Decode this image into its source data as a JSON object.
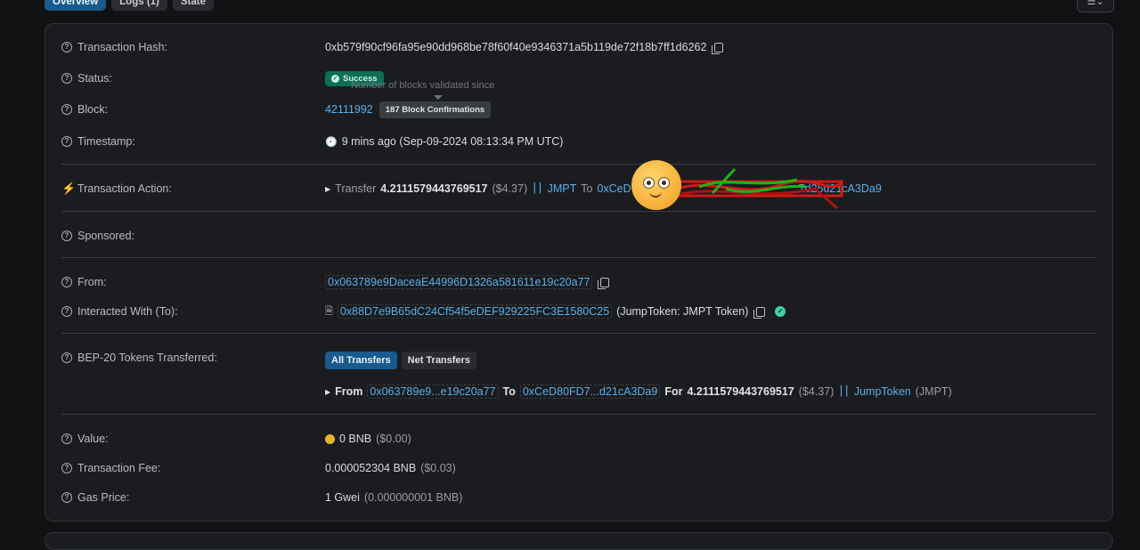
{
  "tabs": [
    {
      "label": "Overview",
      "active": true
    },
    {
      "label": "Logs (1)",
      "active": false
    },
    {
      "label": "State",
      "active": false
    }
  ],
  "view_toggle_icon": "list-view-icon",
  "rows": {
    "tx_hash": {
      "label": "Transaction Hash:",
      "value": "0xb579f90cf96fa95e90dd968be78f60f40e9346371a5b119de72f18b7ff1d6262"
    },
    "status": {
      "label": "Status:",
      "value": "Success",
      "tooltip": "Number of blocks validated since"
    },
    "block": {
      "label": "Block:",
      "value": "42111992",
      "confirmations": "187 Block Confirmations"
    },
    "timestamp": {
      "label": "Timestamp:",
      "value": "9 mins ago (Sep-09-2024 08:13:34 PM UTC)"
    },
    "action": {
      "label": "Transaction Action:",
      "prefix": "Transfer",
      "amount": "4.2111579443769517",
      "usd": "($4.37)",
      "token": "JMPT",
      "to_word": "To",
      "to_start": "0xCeD",
      "to_end": "7d25d21cA3Da9"
    },
    "sponsored": {
      "label": "Sponsored:"
    },
    "from": {
      "label": "From:",
      "value": "0x063789e9DaceaE44996D1326a581611e19c20a77"
    },
    "interacted": {
      "label": "Interacted With (To):",
      "value": "0x88D7e9B65dC24Cf54f5eDEF929225FC3E1580C25",
      "name": "(JumpToken: JMPT Token)"
    },
    "bep20": {
      "label": "BEP-20 Tokens Transferred:",
      "tab_all": "All Transfers",
      "tab_net": "Net Transfers",
      "from_word": "From",
      "from_addr": "0x063789e9...e19c20a77",
      "to_word": "To",
      "to_addr": "0xCeD80FD7...d21cA3Da9",
      "for_word": "For",
      "amount": "4.2111579443769517",
      "usd": "($4.37)",
      "token_name": "JumpToken",
      "token_symbol": "(JMPT)"
    },
    "value": {
      "label": "Value:",
      "amount": "0 BNB",
      "usd": "($0.00)"
    },
    "fee": {
      "label": "Transaction Fee:",
      "amount": "0.000052304 BNB",
      "usd": "($0.03)"
    },
    "gas": {
      "label": "Gas Price:",
      "amount": "1 Gwei",
      "detail": "(0.000000001 BNB)"
    }
  },
  "colors": {
    "accent": "#5aaee8",
    "success": "#0e6e56",
    "background": "#111214",
    "card": "#1b1c1f"
  }
}
